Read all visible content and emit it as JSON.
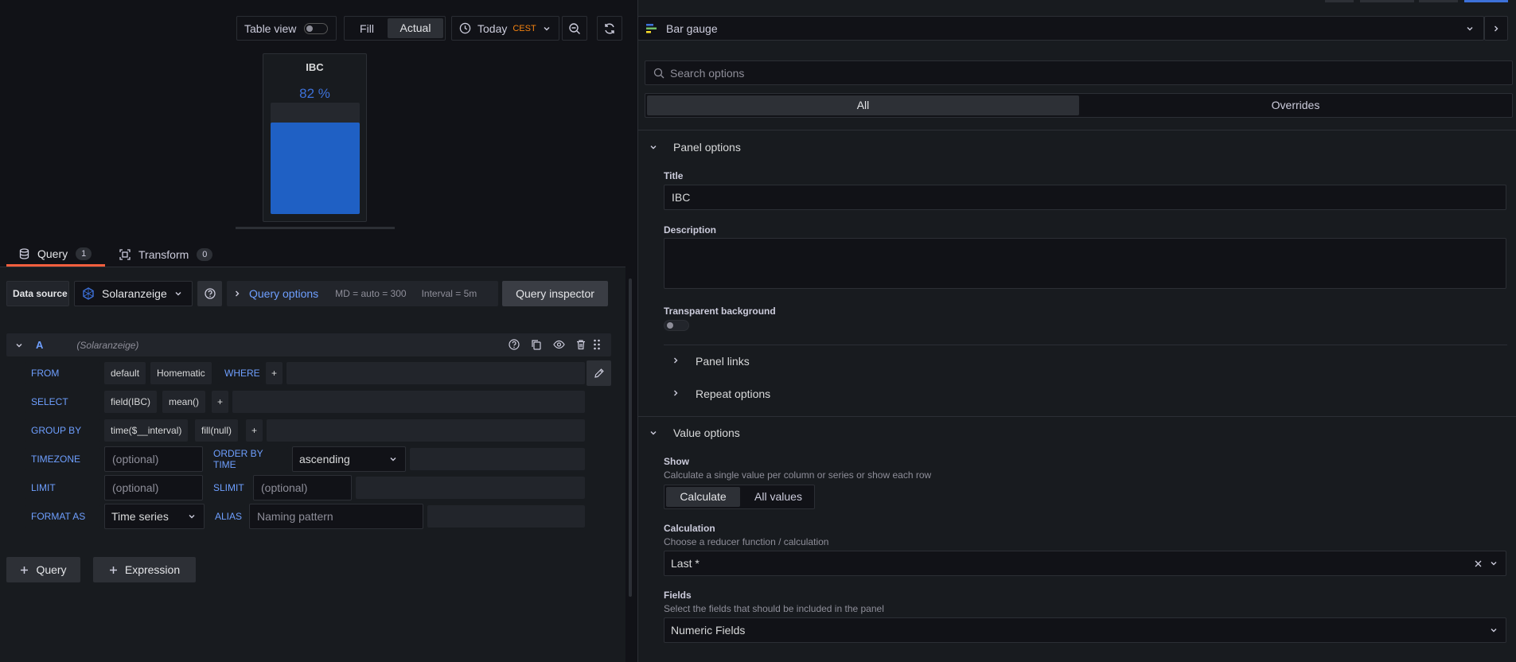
{
  "toolbar": {
    "table_view_label": "Table view",
    "fill_label": "Fill",
    "actual_label": "Actual",
    "time_range_label": "Today",
    "timezone_label": "CEST"
  },
  "viz_picker": {
    "label": "Bar gauge"
  },
  "preview": {
    "title": "IBC",
    "value_text": "82 %",
    "gauge_level": 0.82,
    "gauge_color": "#1f60c4"
  },
  "tabs": [
    {
      "label": "Query",
      "count": "1"
    },
    {
      "label": "Transform",
      "count": "0"
    }
  ],
  "datasource_row": {
    "data_source_label": "Data source",
    "datasource_name": "Solaranzeige",
    "query_options_label": "Query options",
    "md_text": "MD = auto = 300",
    "interval_text": "Interval = 5m",
    "inspector_label": "Query inspector"
  },
  "query": {
    "ref_id": "A",
    "ds_hint": "(Solaranzeige)",
    "from_kw": "FROM",
    "from_policy": "default",
    "from_measurement": "Homematic",
    "where_kw": "WHERE",
    "plus": "+",
    "select_kw": "SELECT",
    "select_field": "field(IBC)",
    "select_fn": "mean()",
    "groupby_kw": "GROUP BY",
    "groupby_time": "time($__interval)",
    "groupby_fill": "fill(null)",
    "timezone_kw": "TIMEZONE",
    "timezone_placeholder": "(optional)",
    "orderby_kw": "ORDER BY TIME",
    "orderby_value": "ascending",
    "limit_kw": "LIMIT",
    "limit_placeholder": "(optional)",
    "slimit_kw": "SLIMIT",
    "slimit_placeholder": "(optional)",
    "format_kw": "FORMAT AS",
    "format_value": "Time series",
    "alias_kw": "ALIAS",
    "alias_placeholder": "Naming pattern"
  },
  "add_buttons": {
    "query_label": "Query",
    "expression_label": "Expression"
  },
  "options_pane": {
    "search_placeholder": "Search options",
    "tab_all": "All",
    "tab_overrides": "Overrides",
    "panel_options_title": "Panel options",
    "title_label": "Title",
    "title_value": "IBC",
    "description_label": "Description",
    "description_value": "",
    "transparent_label": "Transparent background",
    "panel_links_title": "Panel links",
    "repeat_options_title": "Repeat options",
    "value_options_title": "Value options",
    "show_label": "Show",
    "show_desc": "Calculate a single value per column or series or show each row",
    "show_calculate": "Calculate",
    "show_all_values": "All values",
    "calc_label": "Calculation",
    "calc_desc": "Choose a reducer function / calculation",
    "calc_value": "Last *",
    "fields_label": "Fields",
    "fields_desc": "Select the fields that should be included in the panel",
    "fields_value": "Numeric Fields"
  },
  "colors": {
    "accent_orange": "#f5820f",
    "blue_link": "#6e9fff",
    "primary": "#3d71d9"
  }
}
